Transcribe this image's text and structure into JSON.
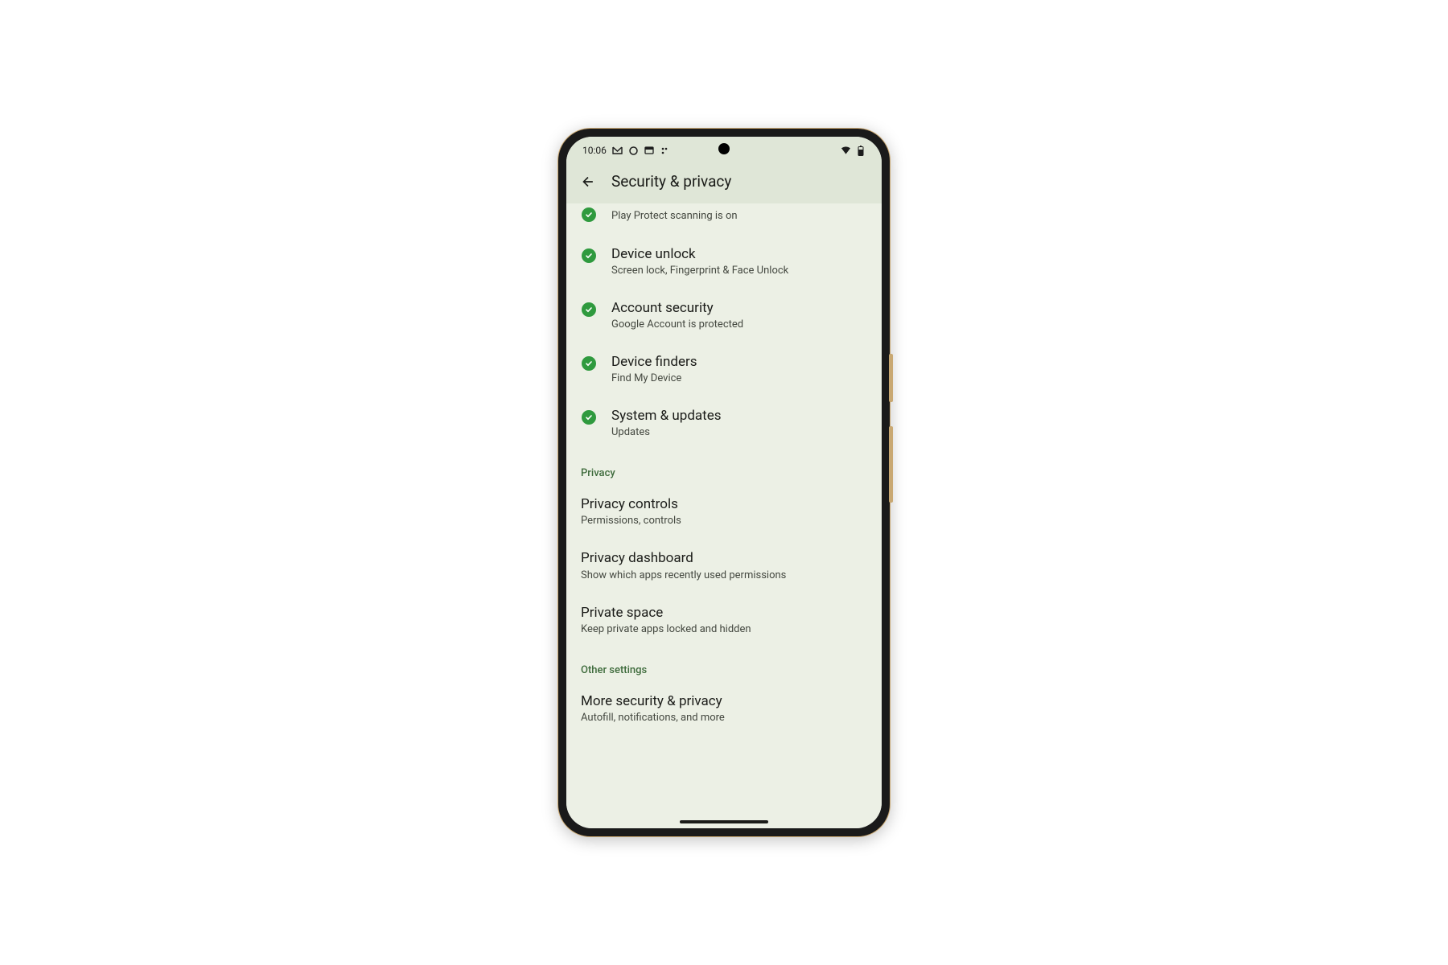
{
  "statusbar": {
    "time": "10:06",
    "icons_left": [
      "gmail",
      "circle",
      "rect",
      "dots"
    ],
    "icons_right": [
      "wifi",
      "battery"
    ]
  },
  "appbar": {
    "title": "Security & privacy"
  },
  "security_items": [
    {
      "key": "play-protect",
      "title": "",
      "sub": "Play Protect scanning is on",
      "partial": true
    },
    {
      "key": "device-unlock",
      "title": "Device unlock",
      "sub": "Screen lock, Fingerprint & Face Unlock",
      "partial": false
    },
    {
      "key": "account-security",
      "title": "Account security",
      "sub": "Google Account is protected",
      "partial": false
    },
    {
      "key": "device-finders",
      "title": "Device finders",
      "sub": "Find My Device",
      "partial": false
    },
    {
      "key": "system-updates",
      "title": "System & updates",
      "sub": "Updates",
      "partial": false
    }
  ],
  "sections": [
    {
      "header": "Privacy",
      "items": [
        {
          "key": "privacy-controls",
          "title": "Privacy controls",
          "sub": "Permissions, controls"
        },
        {
          "key": "privacy-dashboard",
          "title": "Privacy dashboard",
          "sub": "Show which apps recently used permissions"
        },
        {
          "key": "private-space",
          "title": "Private space",
          "sub": "Keep private apps locked and hidden"
        }
      ]
    },
    {
      "header": "Other settings",
      "items": [
        {
          "key": "more-security",
          "title": "More security & privacy",
          "sub": "Autofill, notifications, and more"
        }
      ]
    }
  ]
}
